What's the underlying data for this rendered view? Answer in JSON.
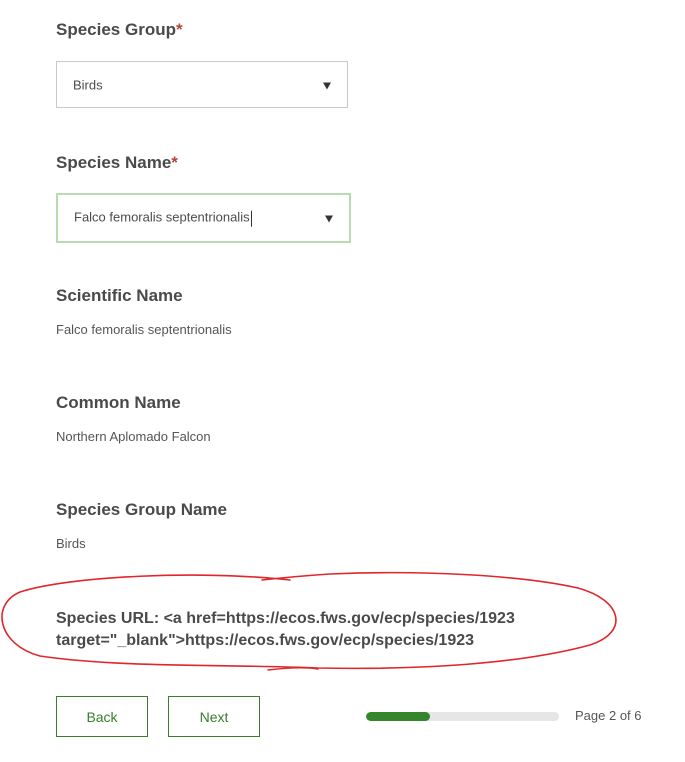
{
  "form": {
    "species_group": {
      "label": "Species Group",
      "required_mark": "*",
      "selected": "Birds"
    },
    "species_name": {
      "label": "Species Name",
      "required_mark": "*",
      "selected": "Falco femoralis septentrionalis"
    },
    "scientific_name": {
      "label": "Scientific Name",
      "value": "Falco femoralis septentrionalis"
    },
    "common_name": {
      "label": "Common Name",
      "value": "Northern Aplomado Falcon"
    },
    "species_group_name": {
      "label": "Species Group Name",
      "value": "Birds"
    },
    "species_url": {
      "text": "Species URL: <a href=https://ecos.fws.gov/ecp/species/1923\ntarget=\"_blank\">https://ecos.fws.gov/ecp/species/1923"
    }
  },
  "footer": {
    "back_label": "Back",
    "next_label": "Next",
    "page_indicator": "Page 2 of 6",
    "progress_fraction": 0.333
  },
  "colors": {
    "accent_green": "#35862b",
    "required_red": "#b5443a",
    "annotation_red": "#e0262a"
  }
}
